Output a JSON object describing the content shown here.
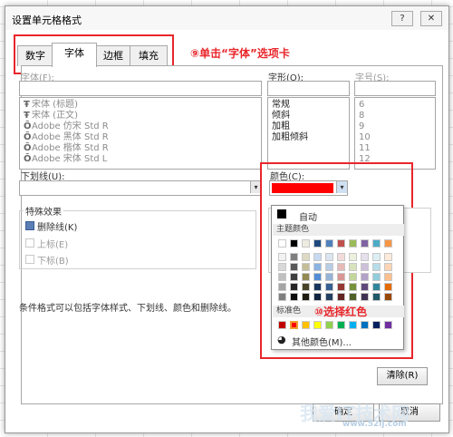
{
  "window": {
    "title": "设置单元格格式",
    "help_label": "?",
    "close_label": "✕"
  },
  "tabs": [
    {
      "label": "数字"
    },
    {
      "label": "字体"
    },
    {
      "label": "边框"
    },
    {
      "label": "填充"
    }
  ],
  "annotations": {
    "step9": "⑨单击“字体”选项卡",
    "step10": "⑩选择红色"
  },
  "font": {
    "label": "字体(F):",
    "value": "",
    "items": [
      {
        "icon": "tt-icon",
        "glyph": "Ŧ",
        "label": "宋体 (标题)"
      },
      {
        "icon": "tt-icon",
        "glyph": "Ŧ",
        "label": "宋体 (正文)"
      },
      {
        "icon": "otf-icon",
        "glyph": "Ō",
        "label": "Adobe 仿宋 Std R"
      },
      {
        "icon": "otf-icon",
        "glyph": "Ō",
        "label": "Adobe 黑体 Std R"
      },
      {
        "icon": "otf-icon",
        "glyph": "Ō",
        "label": "Adobe 楷体 Std R"
      },
      {
        "icon": "otf-icon",
        "glyph": "Ō",
        "label": "Adobe 宋体 Std L"
      }
    ]
  },
  "style": {
    "label": "字形(O):",
    "value": "",
    "items": [
      "常规",
      "倾斜",
      "加粗",
      "加粗倾斜"
    ]
  },
  "size": {
    "label": "字号(S):",
    "value": "",
    "items": [
      "6",
      "8",
      "9",
      "10",
      "11",
      "12"
    ]
  },
  "underline": {
    "label": "下划线(U):",
    "value": ""
  },
  "color": {
    "label": "颜色(C):",
    "value_color": "#ff0000"
  },
  "effects": {
    "label": "特殊效果",
    "strikethrough": {
      "label": "删除线(K)",
      "checked": true
    },
    "superscript": {
      "label": "上标(E)",
      "checked": false
    },
    "subscript": {
      "label": "下标(B)",
      "checked": false
    }
  },
  "note": "条件格式可以包括字体样式、下划线、颜色和删除线。",
  "palette": {
    "auto_label": "自动",
    "theme_label": "主题颜色",
    "standard_label": "标准色",
    "more_label": "其他颜色(M)...",
    "theme_top": [
      "#ffffff",
      "#000000",
      "#eeece1",
      "#1f497d",
      "#4f81bd",
      "#c0504d",
      "#9bbb59",
      "#8064a2",
      "#4bacc6",
      "#f79646"
    ],
    "theme_shades": [
      [
        "#f2f2f2",
        "#7f7f7f",
        "#ddd9c3",
        "#c6d9f0",
        "#dbe5f1",
        "#f2dcdb",
        "#ebf1dd",
        "#e5e0ec",
        "#dbeef3",
        "#fdeada"
      ],
      [
        "#d8d8d8",
        "#595959",
        "#c4bd97",
        "#8db3e2",
        "#b8cce4",
        "#e5b9b7",
        "#d7e3bc",
        "#ccc1d9",
        "#b7dde8",
        "#fbd5b5"
      ],
      [
        "#bfbfbf",
        "#3f3f3f",
        "#938953",
        "#548dd4",
        "#95b3d7",
        "#d99694",
        "#c3d69b",
        "#b2a2c7",
        "#92cddc",
        "#fac08f"
      ],
      [
        "#a5a5a5",
        "#262626",
        "#494429",
        "#17365d",
        "#366092",
        "#953734",
        "#76923c",
        "#5f497a",
        "#31859b",
        "#e36c09"
      ],
      [
        "#7f7f7f",
        "#0c0c0c",
        "#1d1b10",
        "#0f243e",
        "#244061",
        "#632423",
        "#4f6128",
        "#3f3151",
        "#205867",
        "#974806"
      ]
    ],
    "standard": [
      "#c00000",
      "#ff0000",
      "#ffc000",
      "#ffff00",
      "#92d050",
      "#00b050",
      "#00b0f0",
      "#0070c0",
      "#002060",
      "#7030a0"
    ]
  },
  "buttons": {
    "clear": "清除(R)",
    "ok": "确定",
    "cancel": "取消"
  },
  "watermark": {
    "text": "我爱IT技术网",
    "url": "www.52ij.com"
  }
}
